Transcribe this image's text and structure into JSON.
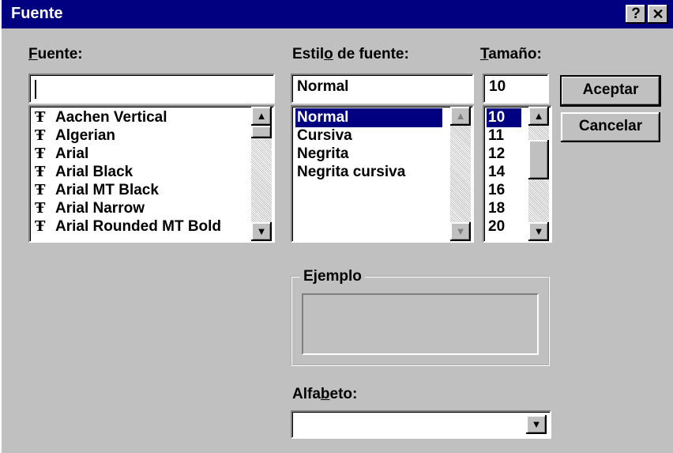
{
  "window": {
    "title": "Fuente",
    "help_label": "?",
    "close_label": "✕"
  },
  "font": {
    "label_first": "F",
    "label_rest": "uente:",
    "value": "",
    "items": [
      "Aachen Vertical",
      "Algerian",
      "Arial",
      "Arial Black",
      "Arial MT Black",
      "Arial Narrow",
      "Arial Rounded MT Bold"
    ]
  },
  "style": {
    "label_pre": "Estil",
    "label_u": "o",
    "label_post": " de fuente:",
    "value": "Normal",
    "items": [
      "Normal",
      "Cursiva",
      "Negrita",
      "Negrita cursiva"
    ],
    "selected": "Normal"
  },
  "size": {
    "label_first": "T",
    "label_rest": "amaño:",
    "value": "10",
    "items": [
      "10",
      "11",
      "12",
      "14",
      "16",
      "18",
      "20"
    ],
    "selected": "10"
  },
  "buttons": {
    "ok": "Aceptar",
    "cancel": "Cancelar"
  },
  "sample": {
    "label": "Ejemplo"
  },
  "charset": {
    "label_pre": "Alfa",
    "label_u": "b",
    "label_post": "eto:",
    "value": ""
  },
  "icons": {
    "font_item": "truetype-icon",
    "up": "scroll-up-icon",
    "down": "scroll-down-icon",
    "dropdown": "dropdown-arrow-icon"
  },
  "colors": {
    "titlebar": "#000080",
    "selection": "#000080",
    "face": "#c0c0c0"
  }
}
